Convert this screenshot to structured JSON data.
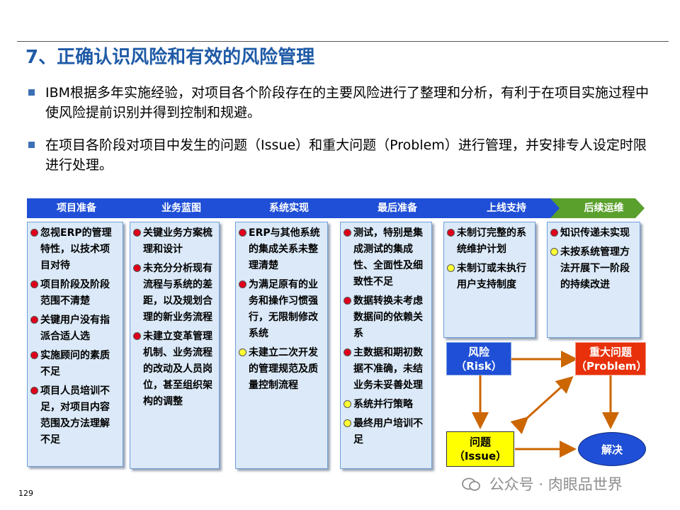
{
  "title": "7、正确认识风险和有效的风险管理",
  "bullets": [
    "IBM根据多年实施经验，对项目各个阶段存在的主要风险进行了整理和分析，有利于在项目实施过程中使风险提前识别并得到控制和规避。",
    "在项目各阶段对项目中发生的问题（Issue）和重大问题（Problem）进行管理，并安排专人设定时限进行处理。"
  ],
  "phases": [
    "项目准备",
    "业务蓝图",
    "系统实现",
    "最后准备",
    "上线支持",
    "后续运维"
  ],
  "colors": {
    "phase_blue": "#1f4fd6",
    "phase_green": "#5aa02c",
    "risk_blue": "#1f4fd6",
    "problem_red": "#e8300a",
    "issue_yellow": "#ffff00",
    "solve_blue": "#1f4fd6",
    "arrow": "#cc6600"
  },
  "columns": [
    {
      "items": [
        {
          "color": "red",
          "text": "忽视ERP的管理特性，以技术项目对待"
        },
        {
          "color": "red",
          "text": "项目阶段及阶段范围不清楚"
        },
        {
          "color": "red",
          "text": "关键用户没有指派合适人选"
        },
        {
          "color": "red",
          "text": "实施顾问的素质不足"
        },
        {
          "color": "red",
          "text": "项目人员培训不足，对项目内容范围及方法理解不足"
        }
      ]
    },
    {
      "items": [
        {
          "color": "red",
          "text": "关键业务方案梳理和设计"
        },
        {
          "color": "red",
          "text": "未充分分析现有流程与系统的差距，以及规划合理的新业务流程"
        },
        {
          "color": "red",
          "text": "未建立变革管理机制、业务流程的改动及人员岗位，甚至组织架构的调整"
        }
      ]
    },
    {
      "items": [
        {
          "color": "red",
          "text": "ERP与其他系统的集成关系未整理清楚"
        },
        {
          "color": "red",
          "text": "为满足原有的业务和操作习惯强行，无限制修改系统"
        },
        {
          "color": "yellow",
          "text": "未建立二次开发的管理规范及质量控制流程"
        }
      ]
    },
    {
      "items": [
        {
          "color": "red",
          "text": "测试，特别是集成测试的集成性、全面性及细致性不足"
        },
        {
          "color": "red",
          "text": "数据转换未考虑数据间的依赖关系"
        },
        {
          "color": "red",
          "text": "主数据和期初数据不准确，未结业务未妥善处理"
        },
        {
          "color": "yellow",
          "text": "系统并行策略"
        },
        {
          "color": "yellow",
          "text": "最终用户培训不足"
        }
      ]
    },
    {
      "items": [
        {
          "color": "red",
          "text": "未制订完整的系统维护计划"
        },
        {
          "color": "yellow",
          "text": "未制订或未执行用户支持制度"
        }
      ]
    },
    {
      "items": [
        {
          "color": "red",
          "text": "知识传递未实现"
        },
        {
          "color": "yellow",
          "text": "未按系统管理方法开展下一阶段的持续改进"
        }
      ]
    }
  ],
  "flow": {
    "risk_line1": "风险",
    "risk_line2": "（Risk）",
    "problem_line1": "重大问题",
    "problem_line2": "（Problem）",
    "issue_line1": "问题",
    "issue_line2": "（Issue）",
    "solve": "解决"
  },
  "page_number": "129",
  "watermark": "公众号 · 肉眼品世界"
}
